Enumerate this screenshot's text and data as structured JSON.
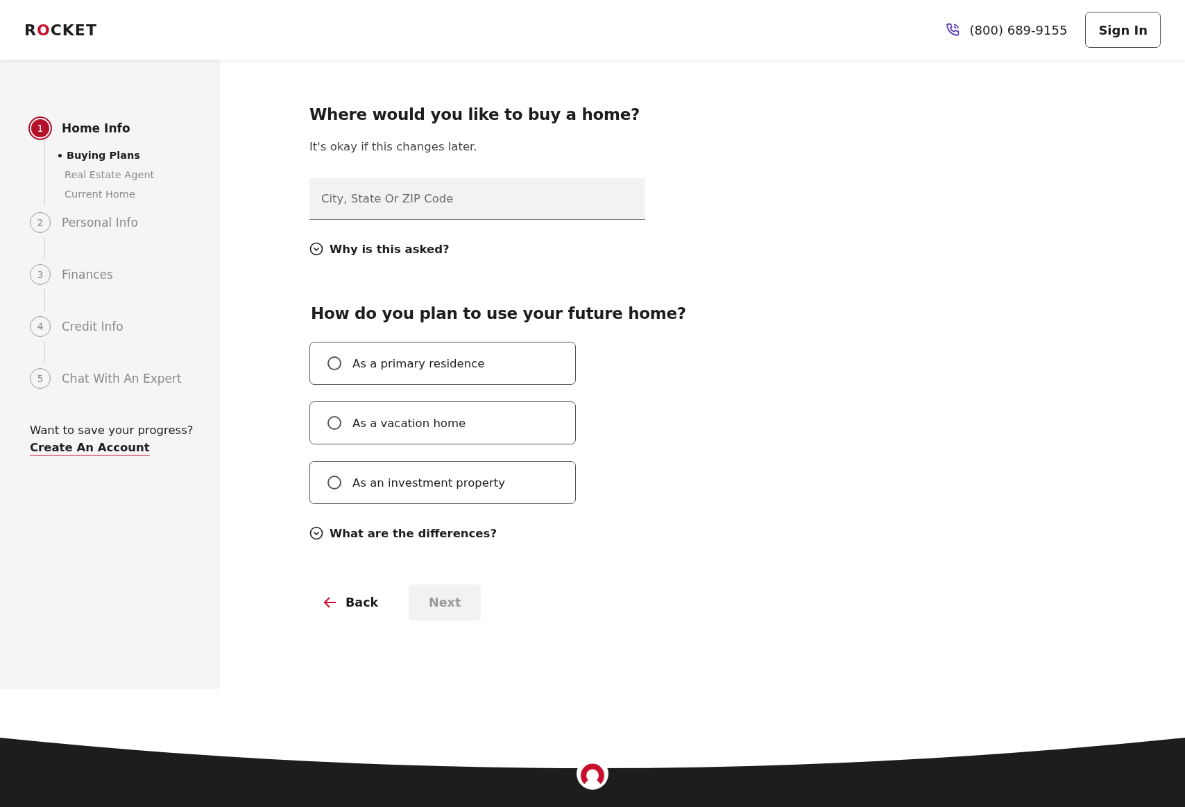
{
  "header": {
    "logo": "ROCKET",
    "phone": "(800) 689-9155",
    "sign_in": "Sign In"
  },
  "sidebar": {
    "steps": [
      {
        "number": "1",
        "label": "Home Info",
        "selected": true,
        "children": [
          {
            "label": "Buying Plans",
            "selected": true
          },
          {
            "label": "Real Estate Agent",
            "selected": false
          },
          {
            "label": "Current Home",
            "selected": false
          }
        ]
      },
      {
        "number": "2",
        "label": "Personal Info",
        "selected": false
      },
      {
        "number": "3",
        "label": "Finances",
        "selected": false
      },
      {
        "number": "4",
        "label": "Credit Info",
        "selected": false
      },
      {
        "number": "5",
        "label": "Chat With An Expert",
        "selected": false
      }
    ],
    "save_prompt": "Want to save your progress?",
    "save_link": "Create An Account"
  },
  "main": {
    "location_question": "Where would you like to buy a home?",
    "location_hint": "It's okay if this changes later.",
    "location_field": {
      "placeholder": "City, State Or ZIP Code"
    },
    "location_help": "Why is this asked?",
    "use_question": "How do you plan to use your future home?",
    "options": [
      {
        "label": "As a primary residence",
        "selected": false
      },
      {
        "label": "As a vacation home",
        "selected": false
      },
      {
        "label": "As an investment property",
        "selected": false
      }
    ],
    "use_help": "What are the differences?",
    "back": "Back",
    "next": {
      "label": "Next",
      "disabled": true
    }
  }
}
